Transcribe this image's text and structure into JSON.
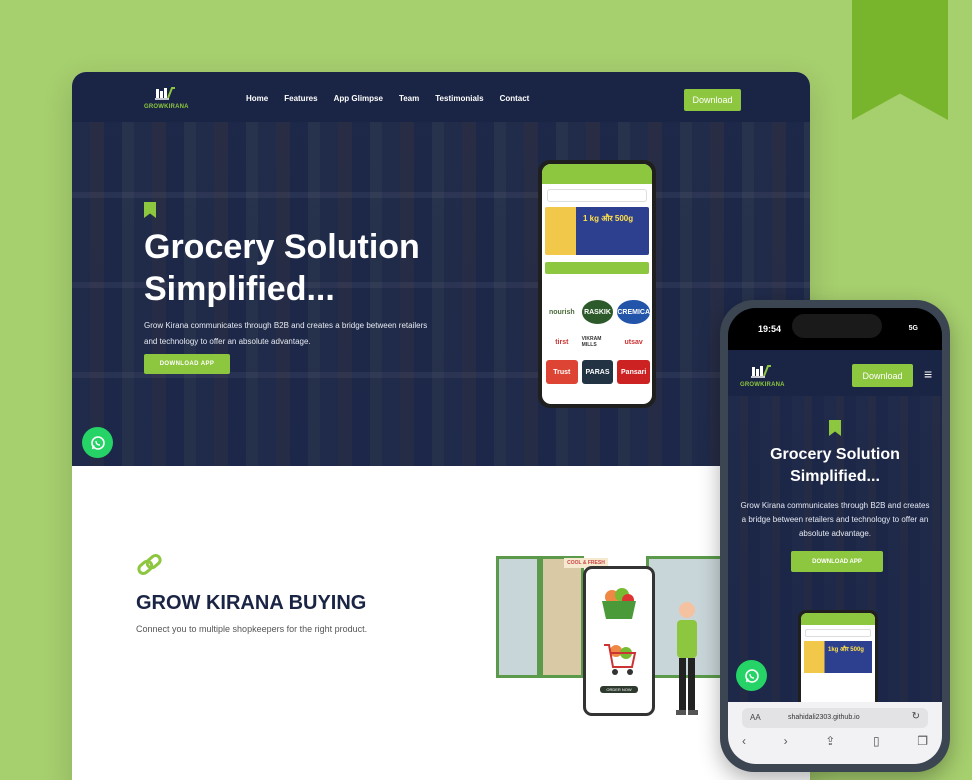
{
  "nav": {
    "logo": {
      "main": "GROW",
      "accent": "KIRANA"
    },
    "links": [
      "Home",
      "Features",
      "App Glimpse",
      "Team",
      "Testimonials",
      "Contact"
    ],
    "download_label": "Download"
  },
  "hero": {
    "title": "Grocery Solution Simplified...",
    "description": "Grow Kirana communicates through B2B and creates a bridge between retailers and technology to offer an absolute advantage.",
    "button_label": "DOWNLOAD APP"
  },
  "hero_phone": {
    "banner_text": "1 kg और 500g",
    "brands": [
      "nourish",
      "RASKIK",
      "CREMICA",
      "tirst",
      "VIKRAM MILLS",
      "utsav",
      "Trust",
      "PARAS",
      "Pansari"
    ]
  },
  "section": {
    "title": "GROW KIRANA BUYING",
    "description": "Connect you to multiple shopkeepers for the right product."
  },
  "illustration": {
    "sign": "COOL & FRESH",
    "order_label": "ORDER NOW"
  },
  "mobile": {
    "time": "19:54",
    "signal": "5G",
    "download_label": "Download",
    "title": "Grocery Solution Simplified...",
    "description": "Grow Kirana communicates through B2B and creates a bridge between retailers and technology to offer an absolute advantage.",
    "button_label": "DOWNLOAD APP",
    "mini_banner": "1kg और 500g",
    "browser": {
      "aa": "AA",
      "url": "shahidali2303.github.io"
    }
  },
  "colors": {
    "background": "#a6cf6e",
    "navy": "#1a2444",
    "accent_green": "#8dc63f",
    "whatsapp": "#25d366"
  }
}
